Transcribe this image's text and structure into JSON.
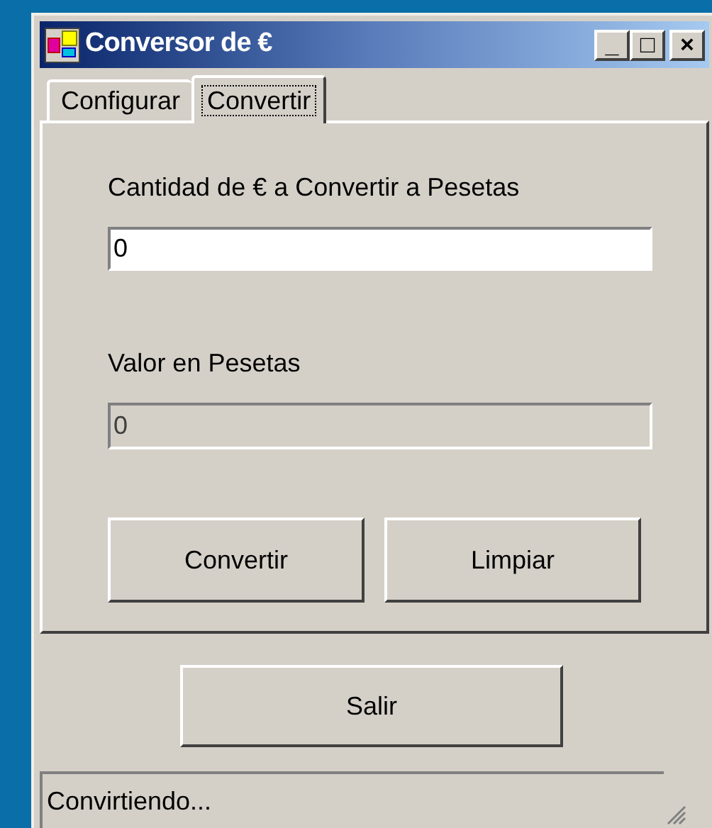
{
  "window": {
    "title": "Conversor de €"
  },
  "title_buttons": [
    "_",
    "□",
    "×"
  ],
  "tabs": [
    {
      "label": "Configurar",
      "selected": false
    },
    {
      "label": "Convertir",
      "selected": true
    }
  ],
  "amount": {
    "label": "Cantidad de € a Convertir a Pesetas",
    "value": "0",
    "disabled": false
  },
  "result": {
    "label": "Valor en Pesetas",
    "value": "0",
    "disabled": true
  },
  "buttons": [
    "Convertir",
    "Limpiar"
  ],
  "exit_button": "Salir",
  "status_bar": "Convirtiendo..."
}
